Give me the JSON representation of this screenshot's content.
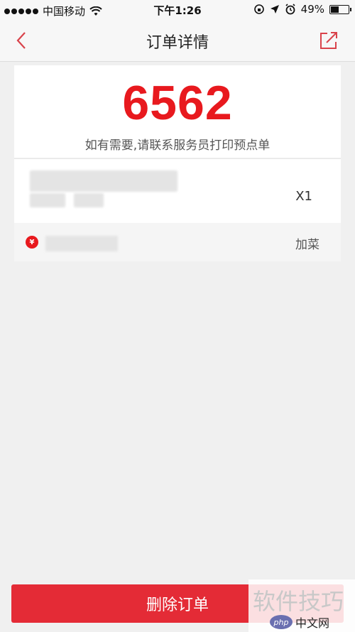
{
  "status_bar": {
    "carrier": "中国移动",
    "time": "下午1:26",
    "battery": "49%"
  },
  "nav": {
    "title": "订单详情"
  },
  "order": {
    "number": "6562",
    "hint": "如有需要,请联系服务员打印预点单"
  },
  "item": {
    "quantity": "X1"
  },
  "add_row": {
    "add_label": "加菜"
  },
  "footer": {
    "delete_label": "删除订单"
  },
  "watermark": {
    "text": "软件技巧",
    "logo": "php",
    "site": "中文网"
  },
  "colors": {
    "accent": "#e8191e",
    "button": "#e42b36"
  }
}
